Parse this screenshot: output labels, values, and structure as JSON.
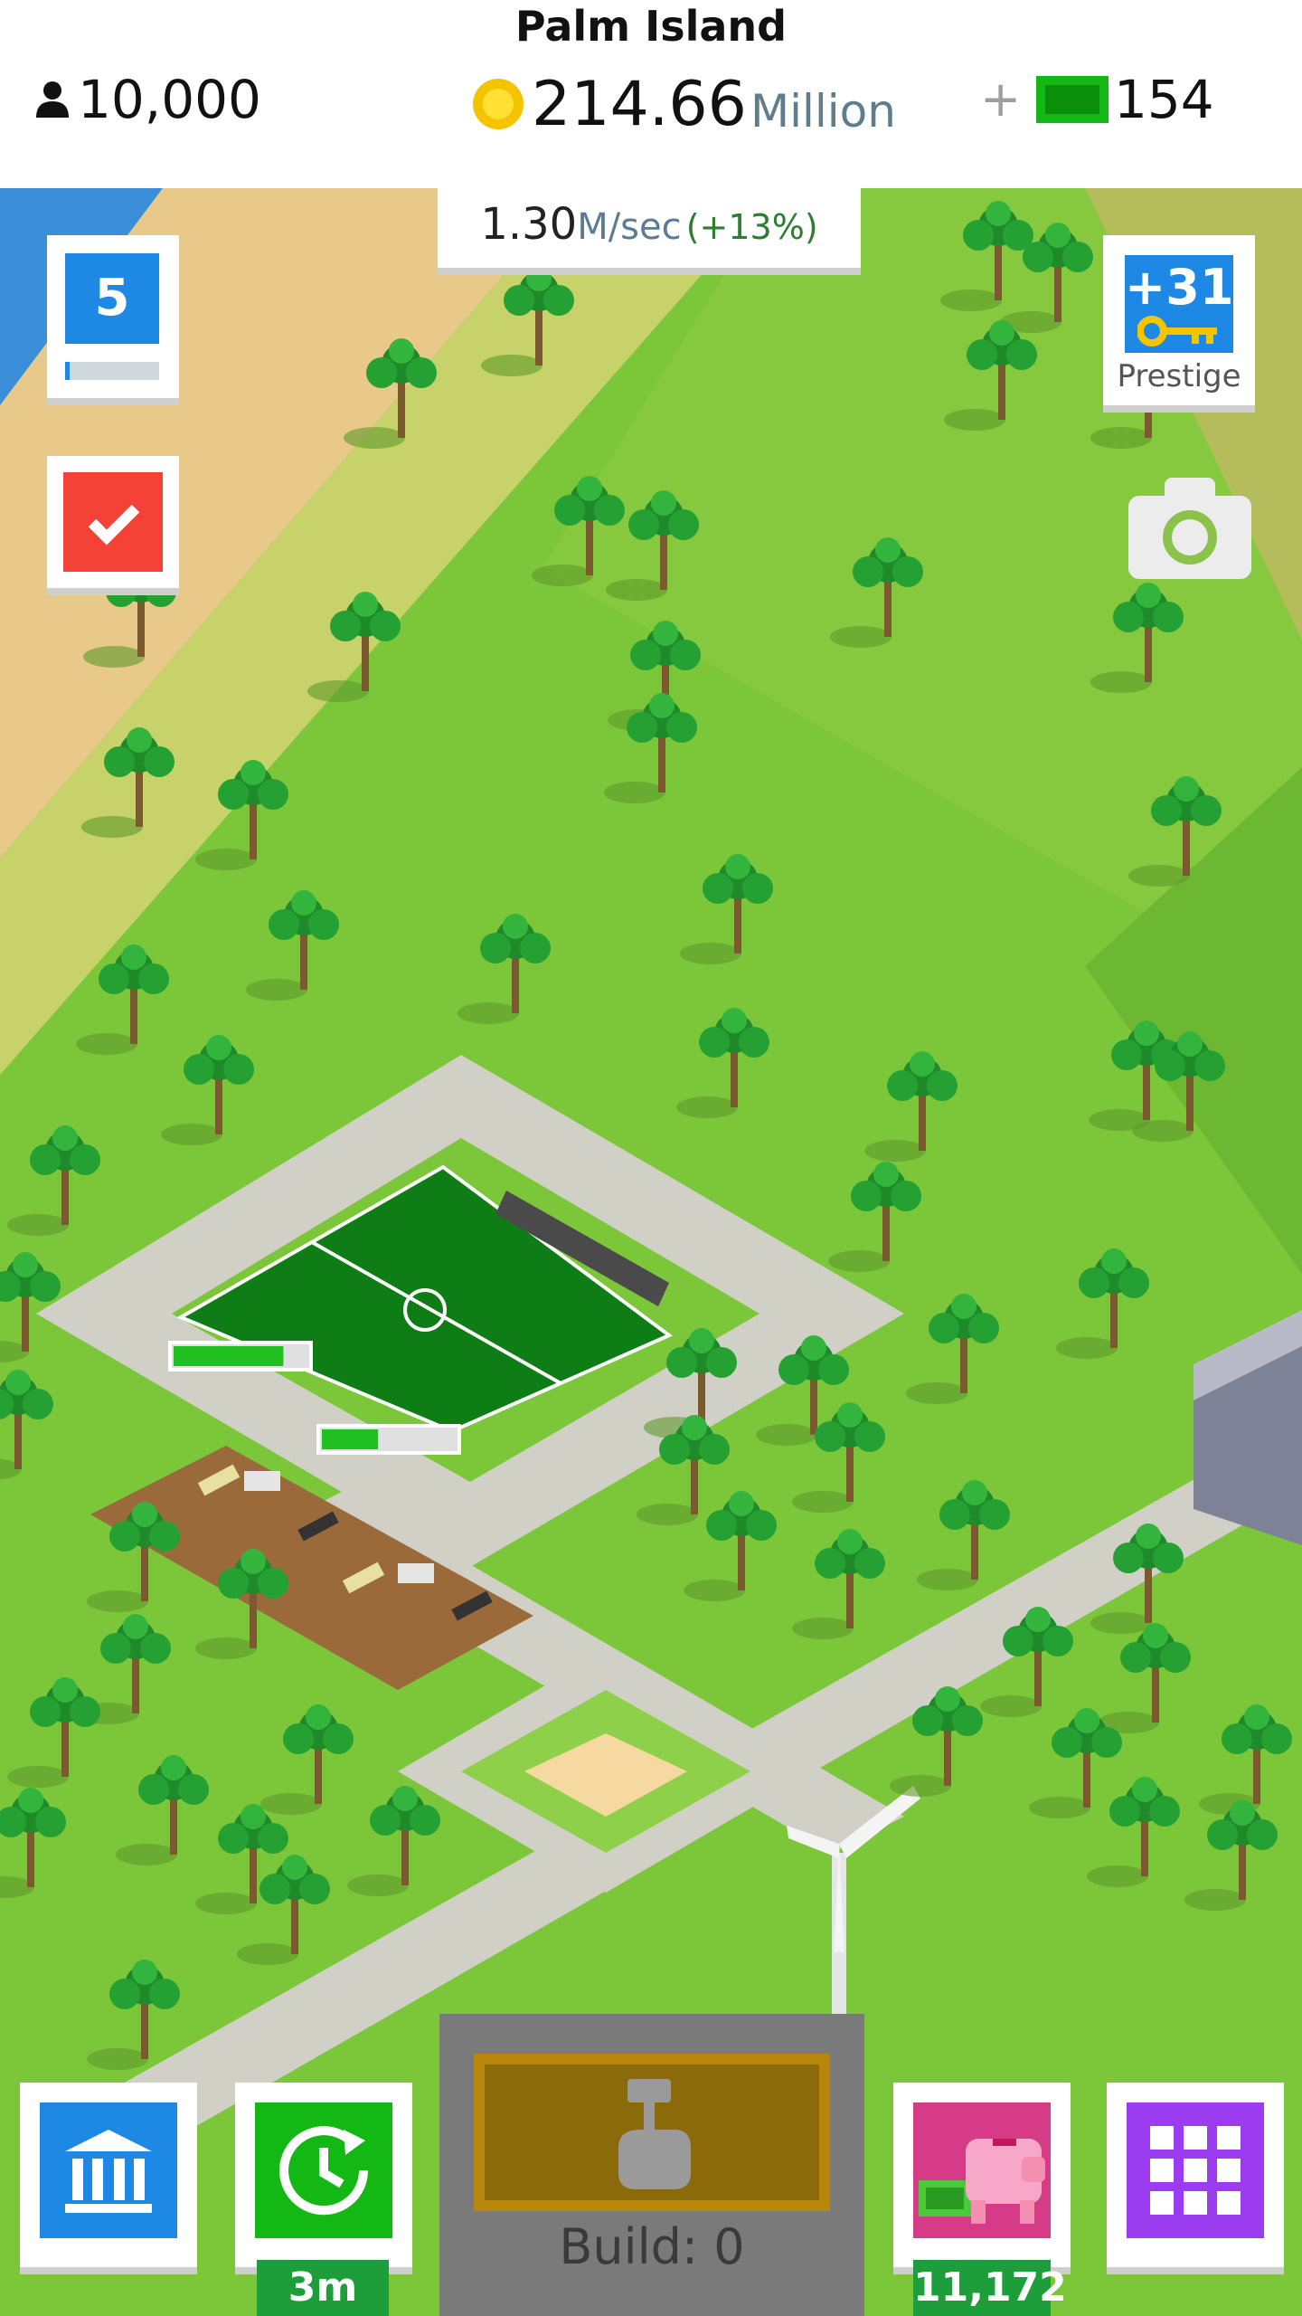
{
  "header": {
    "island_name": "Palm Island",
    "population": "10,000",
    "coins_value": "214.66",
    "coins_unit": "Million",
    "plus": "+",
    "cash": "154"
  },
  "income": {
    "rate": "1.30",
    "unit": "M/sec",
    "bonus": "(+13%)"
  },
  "level": {
    "number": "5",
    "progress": 0.05
  },
  "prestige": {
    "bonus": "+31",
    "label": "Prestige"
  },
  "build": {
    "label": "Build: 0"
  },
  "timer": {
    "badge": "3m"
  },
  "piggy": {
    "badge": "11,172"
  },
  "construction": {
    "progress_1": 0.82,
    "progress_2": 0.42
  },
  "icons": {
    "population": "person-icon",
    "coins": "coin-icon",
    "cash": "cash-icon",
    "tasks": "check-icon",
    "prestige": "key-icon",
    "camera": "camera-icon",
    "build": "hammer-hand-icon",
    "bank": "bank-icon",
    "timer": "clock-forward-icon",
    "piggy": "piggy-bank-icon",
    "menu": "grid-icon"
  },
  "colors": {
    "accent_blue": "#1e88e5",
    "tasks_red": "#f44336",
    "timer_green": "#14b814",
    "piggy_pink": "#d63b87",
    "menu_purple": "#9c3cf0",
    "badge_green": "#1e9e3b",
    "coin_gold": "#f5c400",
    "cash_green": "#14b814",
    "income_green": "#2e7d32"
  }
}
